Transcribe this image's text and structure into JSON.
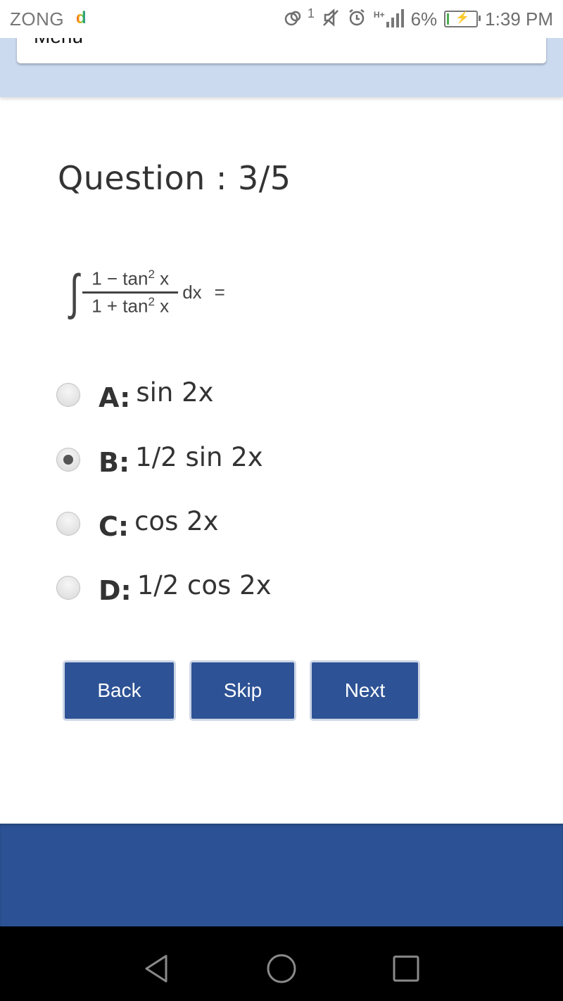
{
  "status_bar": {
    "carrier": "ZONG",
    "carrier_app_icon": "d",
    "sync_badge": "1",
    "network_type": "H+",
    "battery_percent": "6%",
    "battery_level": 0.06,
    "time": "1:39 PM",
    "icons": [
      "sync-icon",
      "mute-icon",
      "alarm-icon",
      "signal-icon",
      "battery-charging-icon"
    ]
  },
  "header": {
    "menu_label": "Menu"
  },
  "question": {
    "title": "Question : 3/5",
    "formula": {
      "integral": "∫",
      "numerator_prefix": "1 − tan",
      "denominator_prefix": "1 + tan",
      "exponent": "2",
      "variable": "x",
      "differential": "dx",
      "equals": "="
    }
  },
  "options": [
    {
      "letter": "A:",
      "text": "sin 2x",
      "selected": false
    },
    {
      "letter": "B:",
      "text": "1/2 sin 2x",
      "selected": true
    },
    {
      "letter": "C:",
      "text": "cos 2x",
      "selected": false
    },
    {
      "letter": "D:",
      "text": "1/2 cos 2x",
      "selected": false
    }
  ],
  "buttons": {
    "back": "Back",
    "skip": "Skip",
    "next": "Next"
  },
  "colors": {
    "primary": "#2d5295",
    "header_band": "#ccdaef"
  },
  "navigation": {
    "back": "back-nav",
    "home": "home-nav",
    "recents": "recents-nav"
  }
}
